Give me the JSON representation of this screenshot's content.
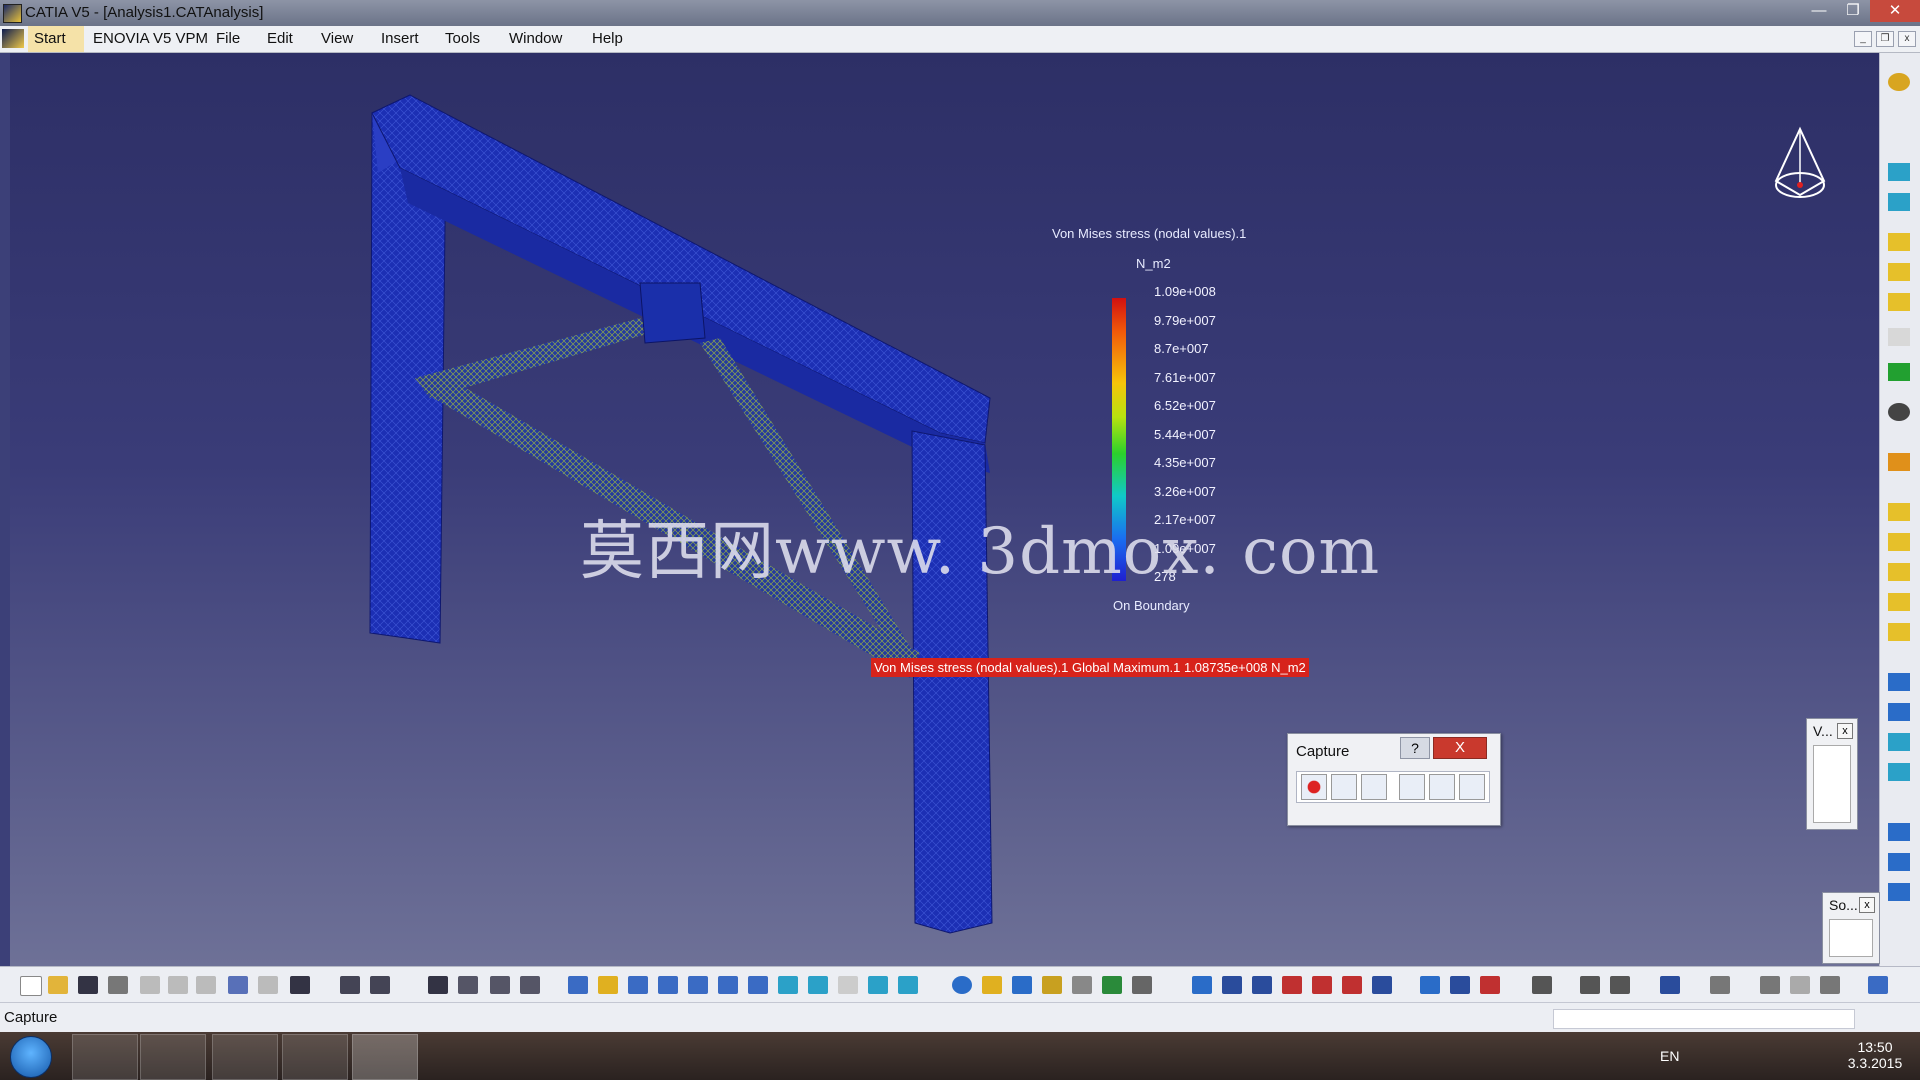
{
  "window": {
    "title": "CATIA V5 - [Analysis1.CATAnalysis]"
  },
  "menu": {
    "start": "Start",
    "items": [
      "ENOVIA V5 VPM",
      "File",
      "Edit",
      "View",
      "Insert",
      "Tools",
      "Window",
      "Help"
    ]
  },
  "legend": {
    "title": "Von Mises stress (nodal values).1",
    "unit": "N_m2",
    "ticks": [
      "1.09e+008",
      "9.79e+007",
      "8.7e+007",
      "7.61e+007",
      "6.52e+007",
      "5.44e+007",
      "4.35e+007",
      "3.26e+007",
      "2.17e+007",
      "1.09e+007",
      "278"
    ],
    "footer": "On Boundary"
  },
  "annotation": {
    "global_max": "Von Mises stress (nodal values).1  Global Maximum.1  1.08735e+008 N_m2"
  },
  "watermark": "莫西网www. 3dmox. com",
  "dialogs": {
    "capture": {
      "title": "Capture",
      "help": "?",
      "close": "X"
    },
    "v_panel": {
      "title": "V..."
    },
    "so_panel": {
      "title": "So..."
    }
  },
  "status": {
    "text": "Capture"
  },
  "taskbar": {
    "lang": "EN",
    "time": "13:50",
    "date": "3.3.2015"
  },
  "colors": {
    "accent_red": "#d7231b",
    "viewport_top": "#2d2f66",
    "mesh_blue": "#1b2fb0"
  }
}
